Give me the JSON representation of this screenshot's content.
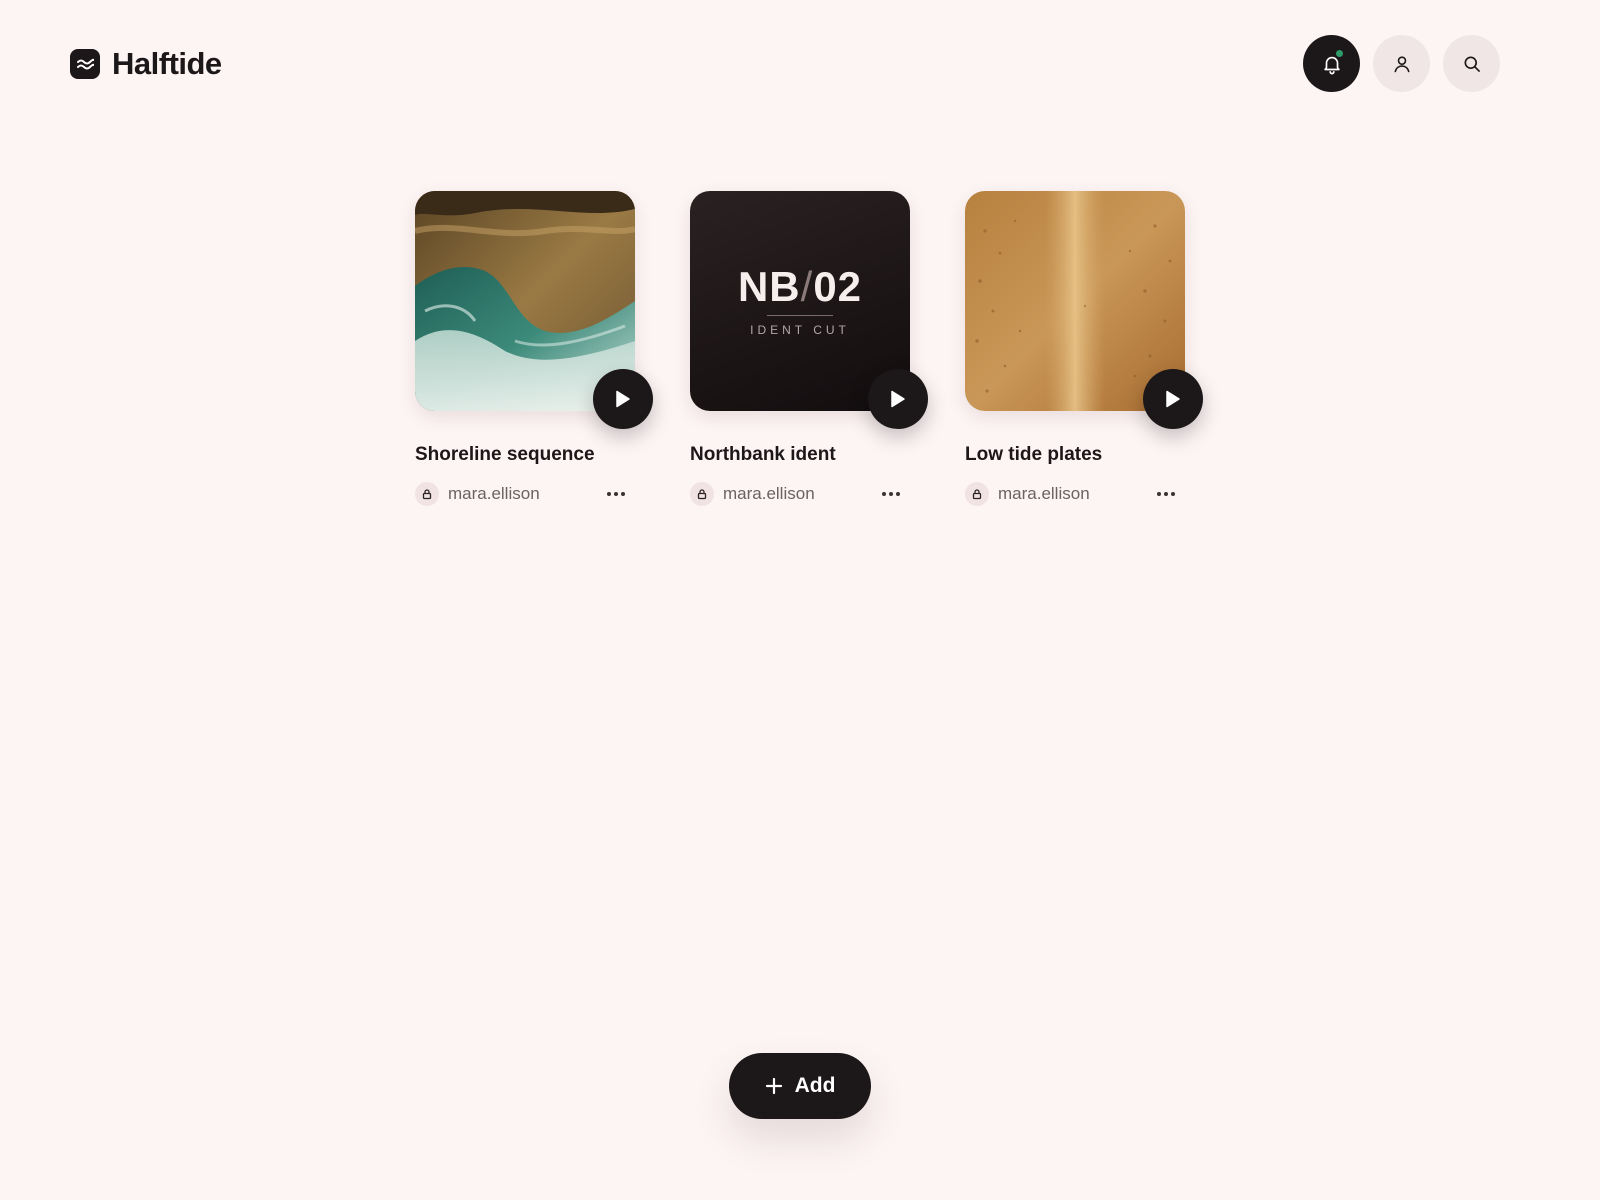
{
  "app": {
    "name": "Halftide",
    "logo_icon": "waves-icon"
  },
  "header": {
    "actions": [
      {
        "name": "notifications",
        "icon": "bell-icon",
        "has_unread": true
      },
      {
        "name": "profile",
        "icon": "user-icon"
      },
      {
        "name": "search",
        "icon": "search-icon"
      }
    ]
  },
  "cards": [
    {
      "title": "Shoreline sequence",
      "owner": "mara.ellison",
      "visibility": "private",
      "thumbnail": "aerial-shoreline-waves"
    },
    {
      "title": "Northbank ident",
      "owner": "mara.ellison",
      "visibility": "private",
      "thumbnail": "title-card",
      "thumb_title_left": "NB",
      "thumb_title_sep": "/",
      "thumb_title_right": "02",
      "thumb_subtitle": "IDENT CUT"
    },
    {
      "title": "Low tide plates",
      "owner": "mara.ellison",
      "visibility": "private",
      "thumbnail": "aerial-sand-road"
    }
  ],
  "add_button": {
    "label": "Add",
    "icon": "plus-icon"
  },
  "colors": {
    "background": "#fdf4f4",
    "ink": "#1c1718",
    "chip": "#f1e6e6",
    "notification_dot": "#2f9b6a"
  }
}
